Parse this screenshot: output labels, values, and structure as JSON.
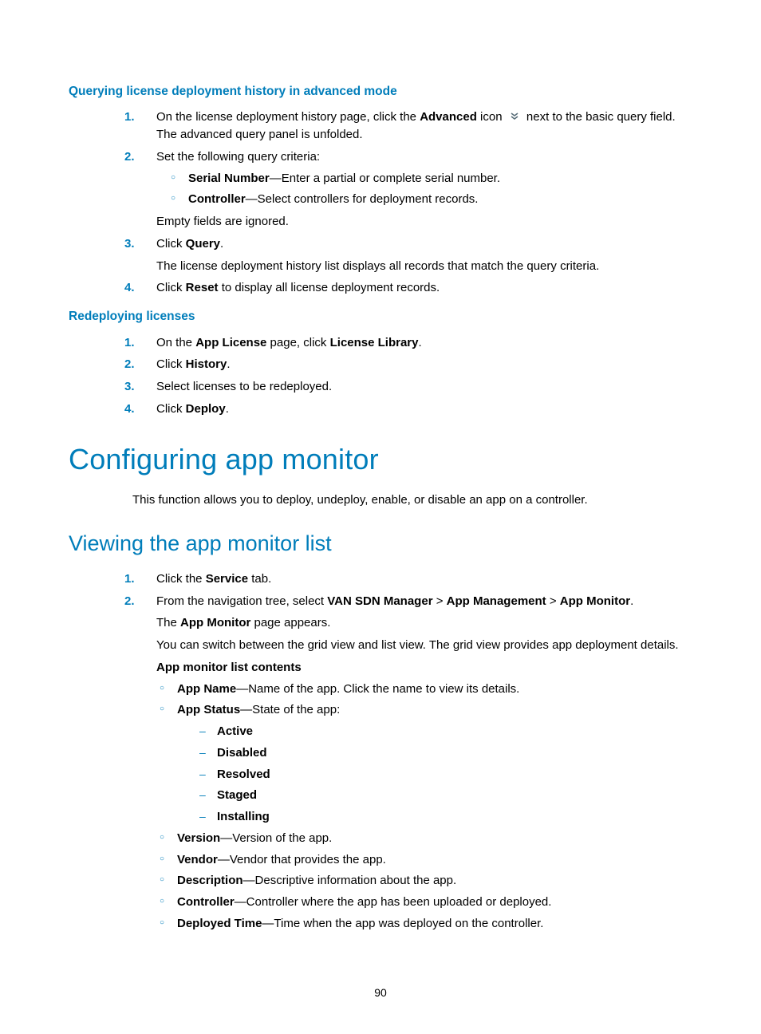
{
  "page_number": "90",
  "sec1": {
    "title": "Querying license deployment history in advanced mode",
    "steps": [
      {
        "num": "1.",
        "pre": "On the license deployment history page, click the ",
        "bold1": "Advanced",
        "mid": " icon ",
        "post": " next to the basic query field. The advanced query panel is unfolded."
      },
      {
        "num": "2.",
        "lead": "Set the following query criteria:",
        "bullets": [
          {
            "b": "Serial Number",
            "t": "—Enter a partial or complete serial number."
          },
          {
            "b": "Controller",
            "t": "—Select controllers for deployment records."
          }
        ],
        "tail": "Empty fields are ignored."
      },
      {
        "num": "3.",
        "pre": "Click ",
        "bold1": "Query",
        "post": ".",
        "tail": "The license deployment history list displays all records that match the query criteria."
      },
      {
        "num": "4.",
        "pre": "Click ",
        "bold1": "Reset",
        "post": " to display all license deployment records."
      }
    ]
  },
  "sec2": {
    "title": "Redeploying licenses",
    "steps": [
      {
        "num": "1.",
        "pre": "On the ",
        "bold1": "App License",
        "mid": " page, click ",
        "bold2": "License Library",
        "post": "."
      },
      {
        "num": "2.",
        "pre": "Click ",
        "bold1": "History",
        "post": "."
      },
      {
        "num": "3.",
        "plain": "Select licenses to be redeployed."
      },
      {
        "num": "4.",
        "pre": "Click ",
        "bold1": "Deploy",
        "post": "."
      }
    ]
  },
  "sec3": {
    "title": "Configuring app monitor",
    "intro": "This function allows you to deploy, undeploy, enable, or disable an app on a controller."
  },
  "sec4": {
    "title": "Viewing the app monitor list",
    "steps": {
      "s1": {
        "num": "1.",
        "pre": "Click the ",
        "bold1": "Service",
        "post": " tab."
      },
      "s2": {
        "num": "2.",
        "pre": "From the navigation tree, select ",
        "b1": "VAN SDN Manager",
        "sep1": " > ",
        "b2": "App Management",
        "sep2": " > ",
        "b3": "App Monitor",
        "post": ".",
        "p2a": "The ",
        "p2b": "App Monitor",
        "p2c": " page appears.",
        "p3": "You can switch between the grid view and list view. The grid view provides app deployment details.",
        "contentsTitle": "App monitor list contents",
        "contents": [
          {
            "b": "App Name",
            "t": "—Name of the app. Click the name to view its details."
          },
          {
            "b": "App Status",
            "t": "—State of the app:",
            "states": [
              "Active",
              "Disabled",
              "Resolved",
              "Staged",
              "Installing"
            ]
          },
          {
            "b": "Version",
            "t": "—Version of the app."
          },
          {
            "b": "Vendor",
            "t": "—Vendor that provides the app."
          },
          {
            "b": "Description",
            "t": "—Descriptive information about the app."
          },
          {
            "b": "Controller",
            "t": "—Controller where the app has been uploaded or deployed."
          },
          {
            "b": "Deployed Time",
            "t": "—Time when the app was deployed on the controller."
          }
        ]
      }
    }
  }
}
